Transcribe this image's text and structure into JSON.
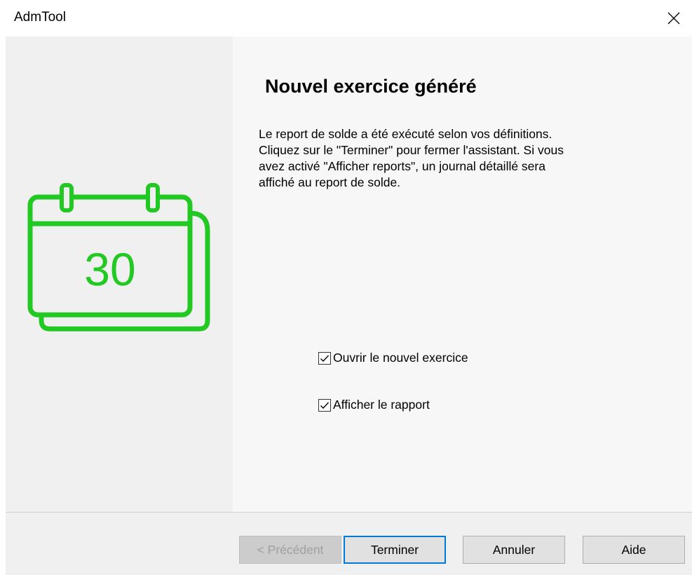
{
  "window": {
    "title": "AdmTool"
  },
  "page": {
    "heading": "Nouvel exercice généré",
    "description_lines": [
      "Le report de solde a été exécuté selon vos définitions.",
      "Cliquez sur le \"Terminer\" pour fermer l'assistant. Si vous",
      "avez activé \"Afficher reports\", un journal détaillé sera",
      "affiché au report de solde."
    ],
    "calendar_day": "30",
    "accent_color": "#22c922"
  },
  "options": [
    {
      "label": "Ouvrir le nouvel exercice",
      "checked": true
    },
    {
      "label": "Afficher le rapport",
      "checked": true
    }
  ],
  "buttons": {
    "previous": "< Précédent",
    "finish": "Terminer",
    "cancel": "Annuler",
    "help": "Aide"
  }
}
